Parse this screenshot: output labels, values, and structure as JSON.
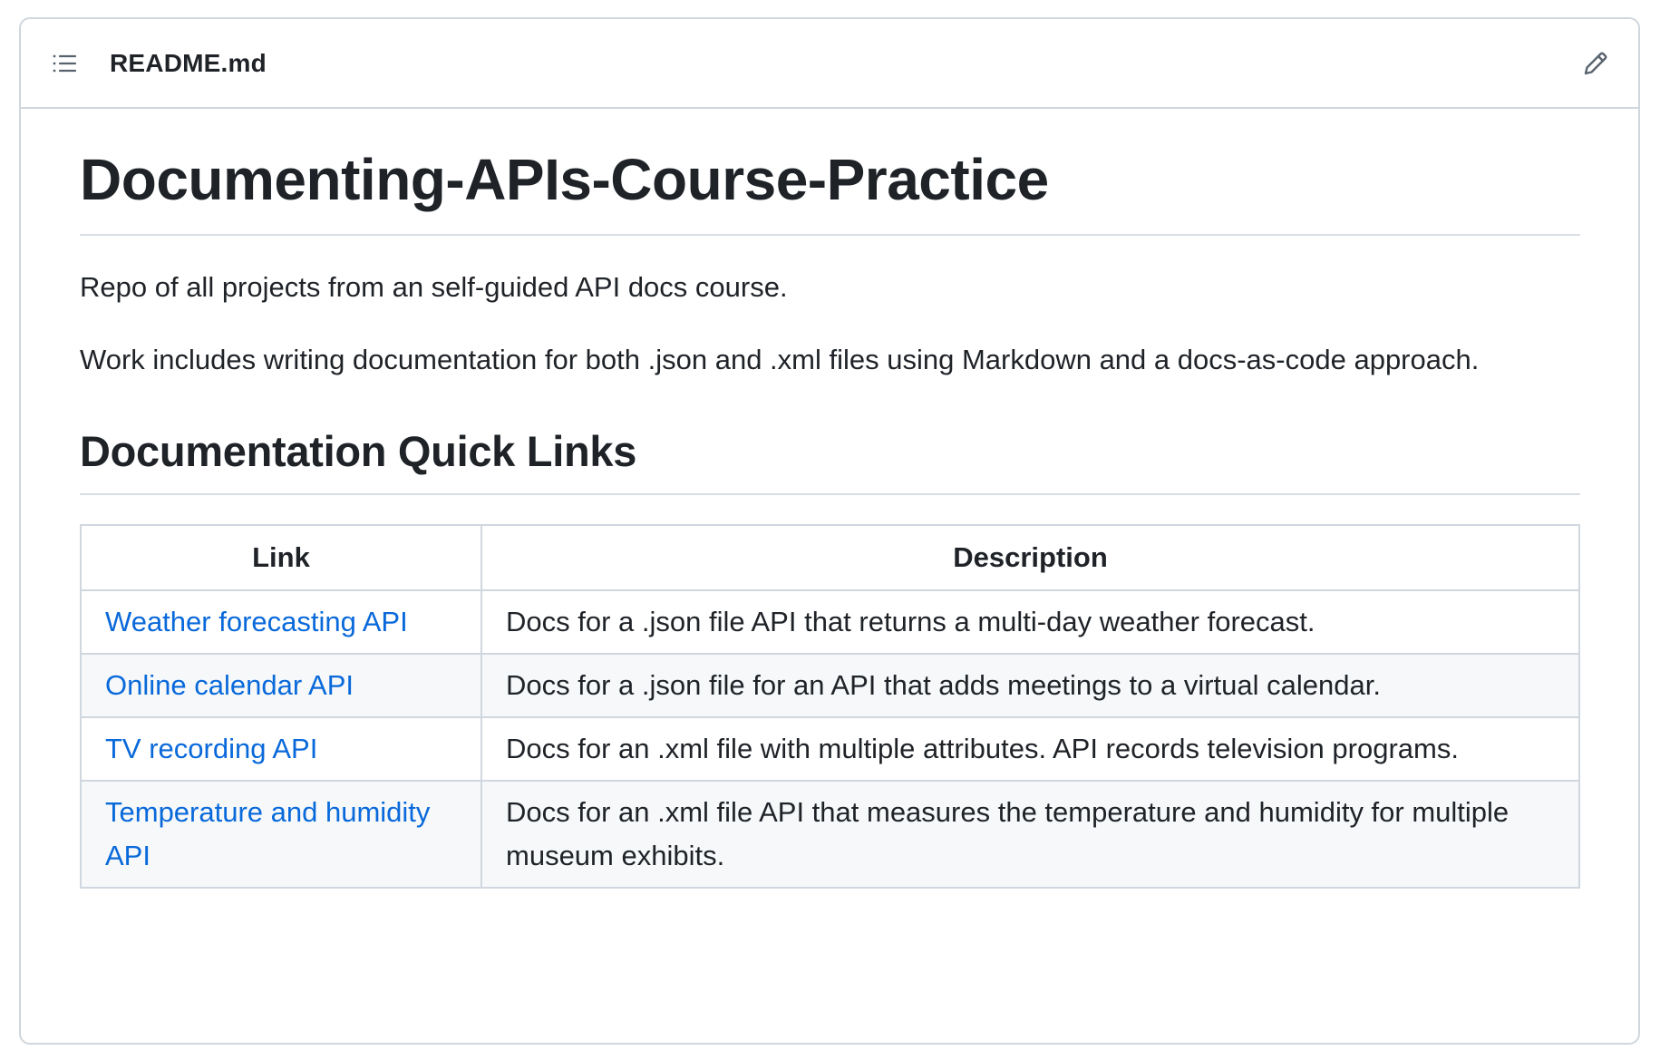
{
  "header": {
    "file_name": "README.md",
    "toc_icon": "list-unordered-icon",
    "edit_icon": "pencil-icon"
  },
  "readme": {
    "title": "Documenting-APIs-Course-Practice",
    "paragraphs": [
      "Repo of all projects from an self-guided API docs course.",
      "Work includes writing documentation for both .json and .xml files using Markdown and a docs-as-code approach."
    ],
    "section_heading": "Documentation Quick Links",
    "table": {
      "headers": [
        "Link",
        "Description"
      ],
      "rows": [
        {
          "link": "Weather forecasting API",
          "description": "Docs for a .json file API that returns a multi-day weather forecast."
        },
        {
          "link": "Online calendar API",
          "description": "Docs for a .json file for an API that adds meetings to a virtual calendar."
        },
        {
          "link": "TV recording API",
          "description": "Docs for an .xml file with multiple attributes. API records television programs."
        },
        {
          "link": "Temperature and humidity API",
          "description": "Docs for an .xml file API that measures the temperature and humidity for multiple museum exhibits."
        }
      ]
    }
  },
  "colors": {
    "link": "#0969da",
    "border": "#d0d7de",
    "row_alt_bg": "#f6f8fa",
    "text": "#1f2328"
  }
}
